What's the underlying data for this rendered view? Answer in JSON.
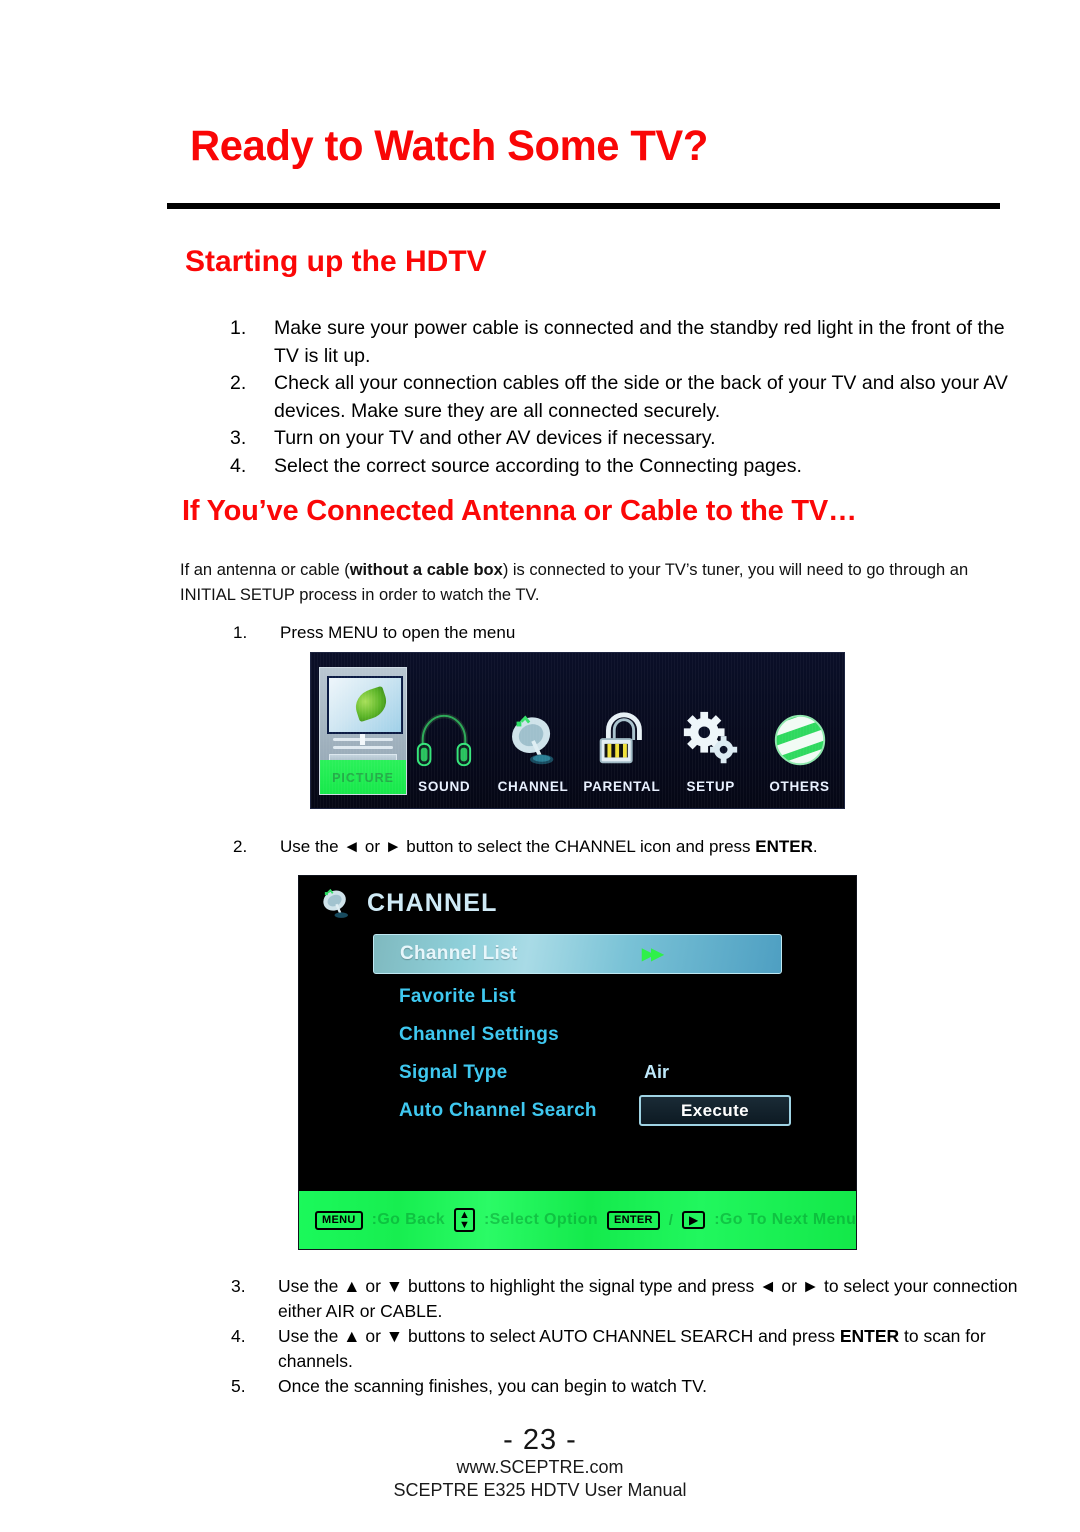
{
  "page": {
    "title": "Ready to Watch Some TV?",
    "number": "- 23 -",
    "footer_site": "www.SCEPTRE.com",
    "footer_manual": "SCEPTRE E325 HDTV User Manual",
    "title_color": "#f90606",
    "heading_color": "#fb0707"
  },
  "sections": {
    "starting": {
      "heading": "Starting up the HDTV",
      "steps": [
        {
          "num": "1.",
          "text": "Make sure your power cable is connected and the standby red light in the front of the TV is lit up."
        },
        {
          "num": "2.",
          "text": "Check all your connection cables off the side or the back of your TV and also your AV devices.  Make sure they are all connected securely."
        },
        {
          "num": "3.",
          "text": "Turn on your TV and other AV devices if necessary."
        },
        {
          "num": "4.",
          "text": "Select the correct source according to the Connecting pages."
        }
      ]
    },
    "antenna": {
      "heading": "If You’ve Connected Antenna or Cable to the TV…",
      "intro_part1": "If an antenna or cable (",
      "intro_bold": "without a cable box",
      "intro_part2": ") is connected to your TV’s tuner, you will need to go through an INITIAL SETUP process in order to watch the TV.",
      "step1": {
        "num": "1.",
        "text": "Press MENU to open the menu"
      },
      "step2": {
        "num": "2.",
        "text_a": "Use the ◄ or ► button to select the CHANNEL icon and press ",
        "bold": "ENTER",
        "text_b": "."
      },
      "steps_tail": [
        {
          "num": "3.",
          "text_a": "Use the ▲ or ▼ buttons to highlight the signal type and press ◄ or ► to select your connection either AIR or CABLE",
          "bold": "",
          "text_b": "."
        },
        {
          "num": "4.",
          "text_a": "Use the ▲ or ▼ buttons to select AUTO CHANNEL SEARCH and press ",
          "bold": "ENTER",
          "text_b": " to scan for channels."
        },
        {
          "num": "5.",
          "text_a": "Once the scanning finishes, you can begin to watch TV.",
          "bold": "",
          "text_b": ""
        }
      ]
    }
  },
  "osd_main_menu": {
    "items": [
      {
        "label": "PICTURE",
        "icon": "picture-tile-icon",
        "selected": true
      },
      {
        "label": "SOUND",
        "icon": "headphones-icon",
        "selected": false
      },
      {
        "label": "CHANNEL",
        "icon": "satellite-dish-icon",
        "selected": false
      },
      {
        "label": "PARENTAL",
        "icon": "padlock-icon",
        "selected": false
      },
      {
        "label": "SETUP",
        "icon": "gears-icon",
        "selected": false
      },
      {
        "label": "OTHERS",
        "icon": "globe-icon",
        "selected": false
      }
    ],
    "highlight_color": "#1ced4e",
    "background_color": "#070a1d"
  },
  "osd_channel_menu": {
    "title": "CHANNEL",
    "title_icon": "satellite-dish-icon",
    "rows": [
      {
        "label": "Channel List",
        "value": "",
        "arrows": "▶▶",
        "highlighted": true
      },
      {
        "label": "Favorite List",
        "value": "",
        "highlighted": false
      },
      {
        "label": "Channel Settings",
        "value": "",
        "highlighted": false
      },
      {
        "label": "Signal Type",
        "value": "Air",
        "highlighted": false
      },
      {
        "label": "Auto Channel Search",
        "value": "",
        "button": "Execute",
        "highlighted": false
      }
    ],
    "footer": {
      "menu_key": "MENU",
      "menu_hint": ":Go Back",
      "updown_hint": ":Select Option",
      "enter_key": "ENTER",
      "separator": "/",
      "right_arrow": "▶",
      "enter_hint": ":Go To Next Menu"
    },
    "accent_color": "#3fc8f0",
    "footer_color": "#19f055"
  }
}
